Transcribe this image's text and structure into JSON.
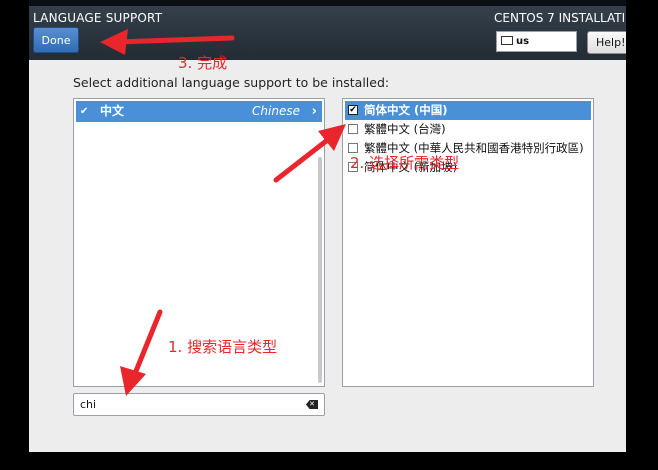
{
  "header": {
    "title": "LANGUAGE SUPPORT",
    "done_label": "Done",
    "installer_title": "CENTOS 7 INSTALLATIO",
    "keyboard_layout": "us",
    "help_label": "Help!"
  },
  "instruction": "Select additional language support to be installed:",
  "language_list": [
    {
      "native": "中文",
      "english": "Chinese",
      "selected": true
    }
  ],
  "locale_list": [
    {
      "label": "简体中文 (中国)",
      "checked": true,
      "selected": true
    },
    {
      "label": "繁體中文 (台灣)",
      "checked": false,
      "selected": false
    },
    {
      "label": "繁體中文 (中華人民共和國香港特別行政區)",
      "checked": false,
      "selected": false
    },
    {
      "label": "简体中文 (新加坡)",
      "checked": false,
      "selected": false
    }
  ],
  "search": {
    "value": "chi"
  },
  "annotations": {
    "step1": "1. 搜索语言类型",
    "step2": "2. 选择所需类型",
    "step3": "3. 完成"
  },
  "colors": {
    "accent": "#4a90d9",
    "header_bg": "#2b333b",
    "annotation": "#e8262c"
  }
}
